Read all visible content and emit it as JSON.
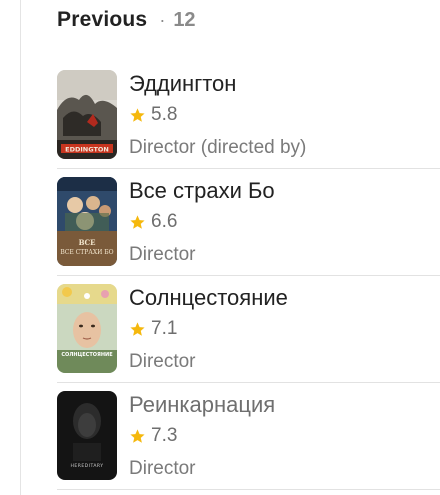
{
  "header": {
    "title": "Previous",
    "separator": "·",
    "count": "12"
  },
  "star_color": "#f5b80d",
  "items": [
    {
      "title": "Эддингтон",
      "rating": "5.8",
      "role": "Director (directed by)",
      "poster_label": "EDDINGTON"
    },
    {
      "title": "Все страхи Бо",
      "rating": "6.6",
      "role": "Director",
      "poster_label": "ВСЕ СТРАХИ БО"
    },
    {
      "title": "Солнцестояние",
      "rating": "7.1",
      "role": "Director",
      "poster_label": "СОЛНЦЕСТОЯНИЕ"
    },
    {
      "title": "Реинкарнация",
      "rating": "7.3",
      "role": "Director",
      "poster_label": "HEREDITARY"
    }
  ]
}
